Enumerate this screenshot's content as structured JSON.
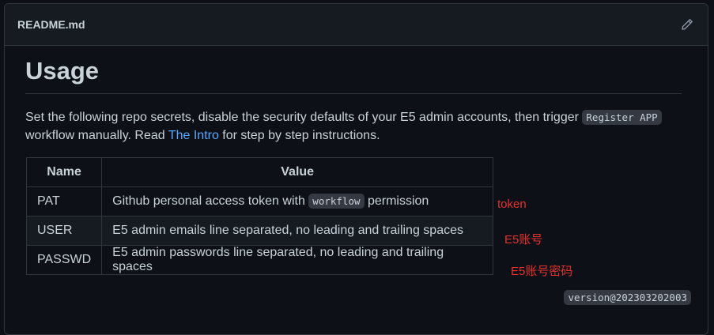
{
  "file": {
    "name": "README.md",
    "edit_icon": "pencil-icon"
  },
  "content": {
    "heading": "Usage",
    "para_1": "Set the following repo secrets, disable the security defaults of your E5 admin accounts, then trigger ",
    "code_register": "Register APP",
    "para_2": " workflow manually. Read ",
    "link_intro": "The Intro",
    "para_3": " for step by step instructions."
  },
  "table": {
    "headers": [
      "Name",
      "Value"
    ],
    "rows": [
      {
        "name": "PAT",
        "value_pre": "Github personal access token with ",
        "value_code": "workflow",
        "value_post": " permission"
      },
      {
        "name": "USER",
        "value": "E5 admin emails line separated, no leading and trailing spaces"
      },
      {
        "name": "PASSWD",
        "value": "E5 admin passwords line separated, no leading and trailing spaces"
      }
    ]
  },
  "annotations": [
    "token",
    "E5账号",
    "E5账号密码"
  ],
  "version": "version@202303202003",
  "colors": {
    "background": "#0d1117",
    "text": "#c9d1d9",
    "link": "#58a6ff",
    "annotation": "#e5312e",
    "border": "#30363d"
  }
}
